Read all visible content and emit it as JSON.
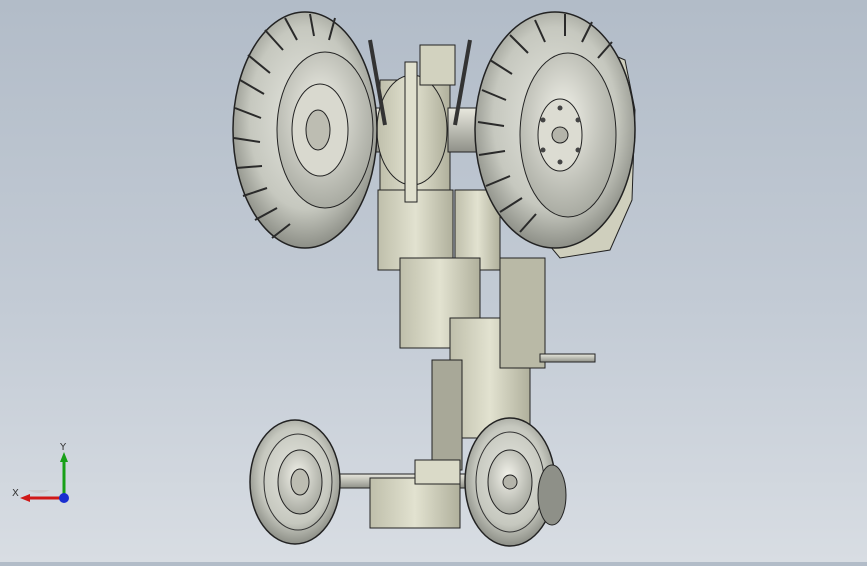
{
  "viewport": {
    "model": "tractor-assembly-isometric-underside",
    "background_top": "#b2bcc8",
    "background_bottom": "#d8dde3",
    "body_color": "#d6d6c4",
    "tire_color": "#c9cbc3"
  },
  "triad": {
    "x_label": "X",
    "y_label": "Y",
    "x_color": "#d01818",
    "y_color": "#18a018",
    "z_color": "#1a2fd0"
  }
}
